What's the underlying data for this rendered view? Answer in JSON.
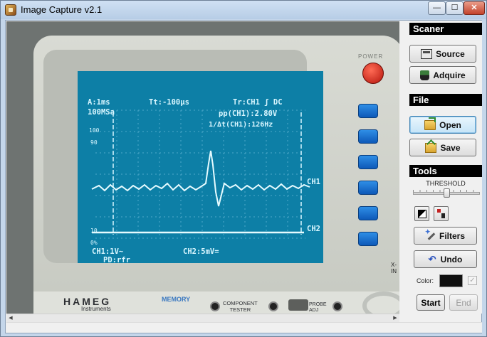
{
  "window": {
    "title": "Image Capture v2.1",
    "controls": {
      "minimize": "—",
      "maximize": "☐",
      "close": "✕"
    }
  },
  "image": {
    "screen_text": {
      "timebase": "A:1ms",
      "sample_rate": "100MSa",
      "trigger_time": "Tt:-100μs",
      "trigger": "Tr:CH1 ʃ DC",
      "peak_to_peak": "pp(CH1):2.80V",
      "frequency": "1/Δt(CH1):126Hz",
      "scale_100": "100",
      "scale_90": "90",
      "scale_10": "10",
      "scale_0": "0%",
      "ch1_marker": "CH1",
      "ch2_marker": "CH2",
      "pd": "PD:rfr",
      "ch1_scale": "CH1:1V~",
      "ch2_scale": "CH2:5mV="
    },
    "labels": {
      "power": "POWER",
      "brand": "HAMEG",
      "brand_sub": "Instruments",
      "memory": "MEMORY",
      "component_tester_1": "COMPONENT",
      "component_tester_2": "TESTER",
      "probe_1": "PROBE",
      "probe_2": "ADJ",
      "xin": "X-IN"
    }
  },
  "scrollbar": {
    "left_arrow": "◀",
    "right_arrow": "▶"
  },
  "panel": {
    "scanner": {
      "header": "Scaner",
      "source_label": "Source",
      "source_icon": "scanner-icon",
      "adquire_label": "Adquire",
      "adquire_icon": "camera-icon"
    },
    "file": {
      "header": "File",
      "open_label": "Open",
      "open_icon": "folder-open-icon",
      "save_label": "Save",
      "save_icon": "folder-save-icon"
    },
    "tools": {
      "header": "Tools",
      "threshold_label": "THRESHOLD",
      "threshold_value": 0.5,
      "filters_label": "Filters",
      "filters_icon": "magic-wand-icon",
      "undo_label": "Undo",
      "undo_icon": "undo-arrow-icon",
      "undo_glyph": "↶",
      "color_label": "Color:",
      "color_value": "#111111",
      "color_checked": true,
      "check_glyph": "✓",
      "start_label": "Start",
      "end_label": "End"
    }
  }
}
